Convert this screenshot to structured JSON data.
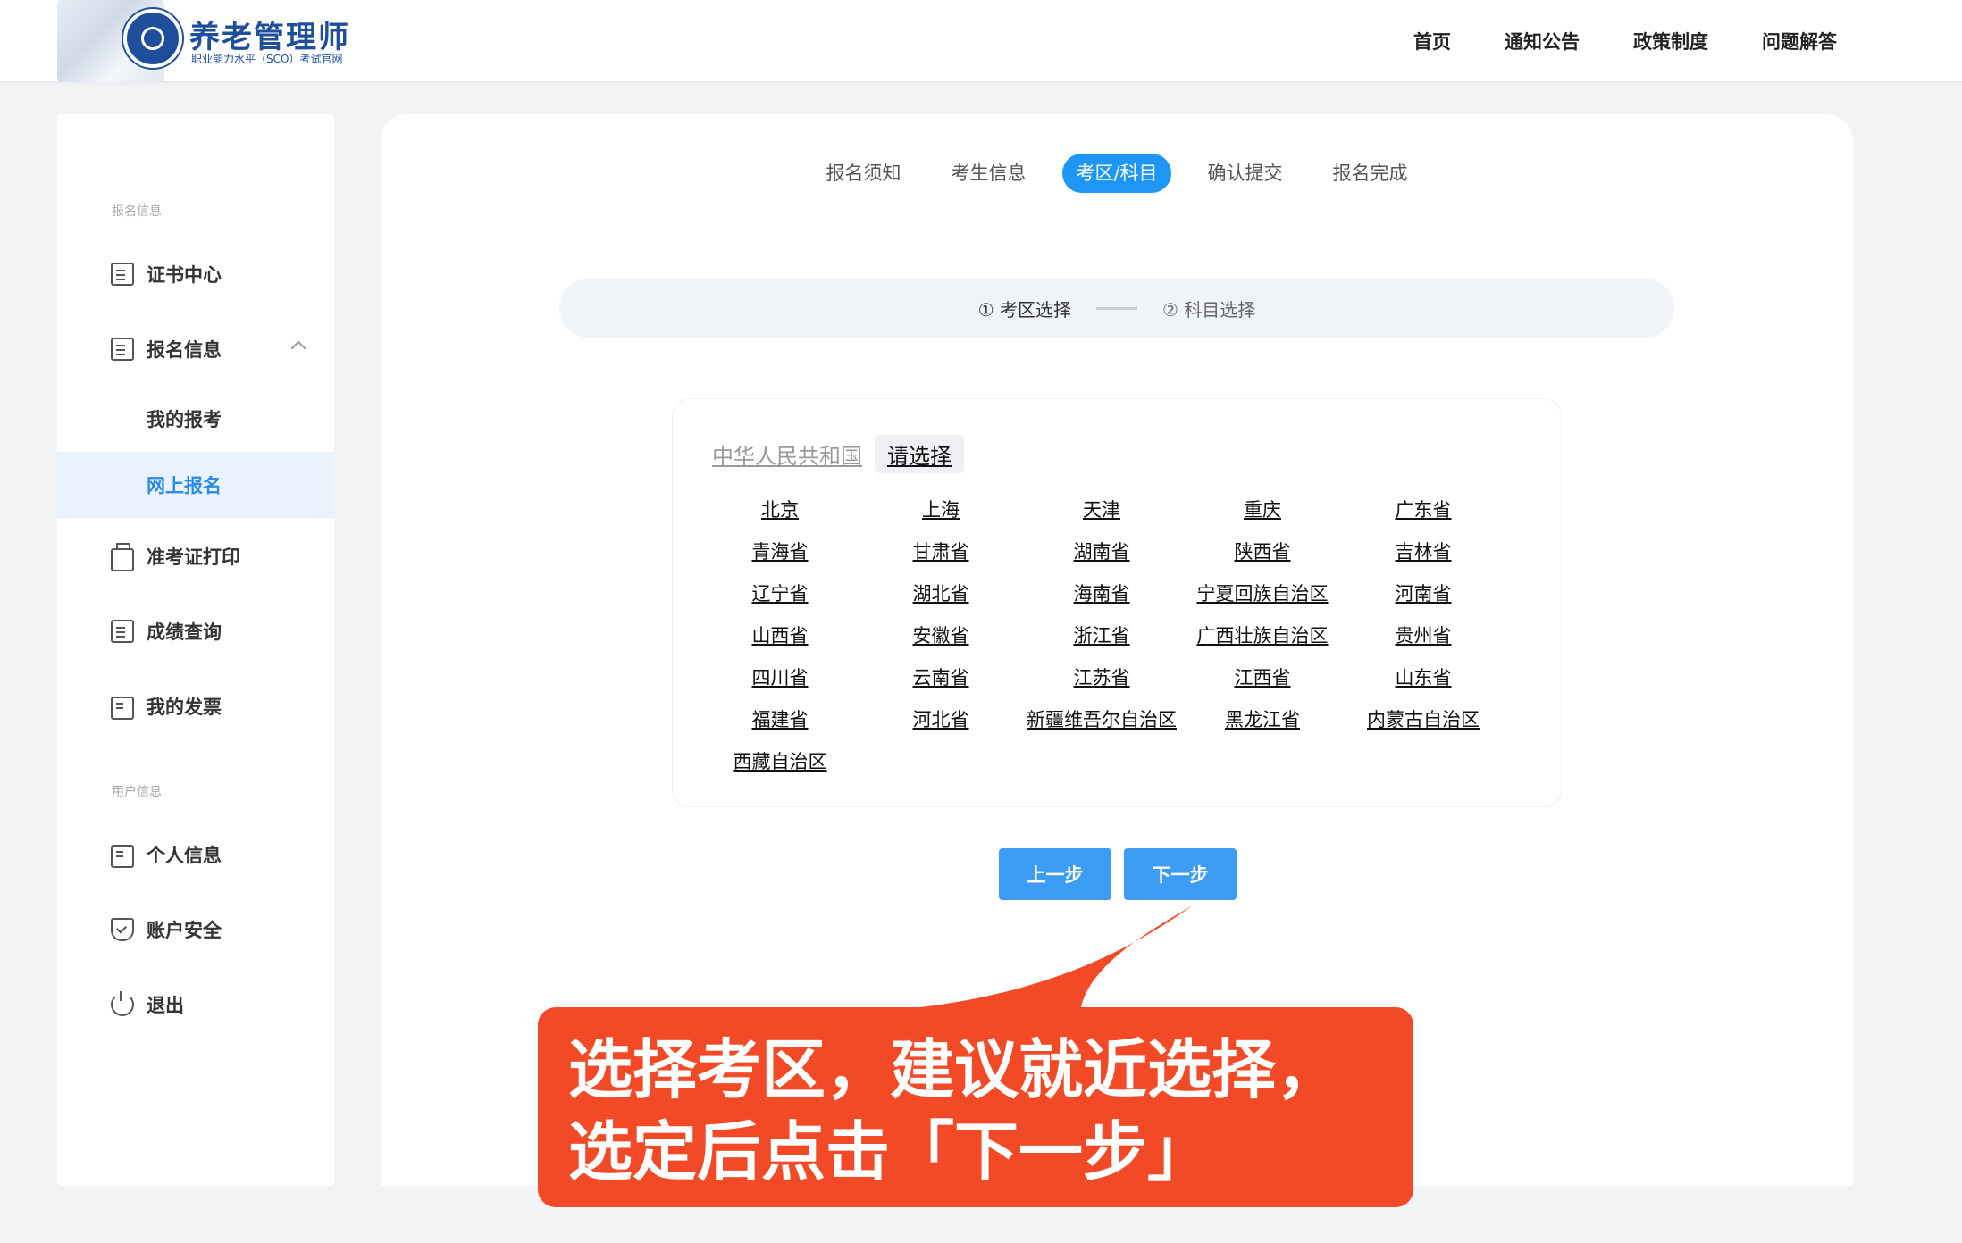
{
  "brand": {
    "title": "养老管理师",
    "subtitle": "职业能力水平（SCO）考试官网"
  },
  "topnav": [
    "首页",
    "通知公告",
    "政策制度",
    "问题解答"
  ],
  "sidebar": {
    "group1": "报名信息",
    "items": {
      "cert": "证书中心",
      "signup": "报名信息",
      "my_exam": "我的报考",
      "online": "网上报名",
      "ticket": "准考证打印",
      "score": "成绩查询",
      "invoice": "我的发票"
    },
    "group2": "用户信息",
    "items2": {
      "profile": "个人信息",
      "security": "账户安全",
      "logout": "退出"
    }
  },
  "steps": [
    "报名须知",
    "考生信息",
    "考区/科目",
    "确认提交",
    "报名完成"
  ],
  "active_step": "考区/科目",
  "substeps": {
    "one": "① 考区选择",
    "two": "② 科目选择"
  },
  "region": {
    "country": "中华人民共和国",
    "placeholder": "请选择",
    "provinces": [
      "北京",
      "上海",
      "天津",
      "重庆",
      "广东省",
      "青海省",
      "甘肃省",
      "湖南省",
      "陕西省",
      "吉林省",
      "辽宁省",
      "湖北省",
      "海南省",
      "宁夏回族自治区",
      "河南省",
      "山西省",
      "安徽省",
      "浙江省",
      "广西壮族自治区",
      "贵州省",
      "四川省",
      "云南省",
      "江苏省",
      "江西省",
      "山东省",
      "福建省",
      "河北省",
      "新疆维吾尔自治区",
      "黑龙江省",
      "内蒙古自治区",
      "西藏自治区"
    ]
  },
  "buttons": {
    "prev": "上一步",
    "next": "下一步"
  },
  "callout": {
    "line1": "选择考区，建议就近选择，",
    "line2": "选定后点击「下一步」"
  },
  "colors": {
    "accent": "#1e96f5",
    "button": "#3c9bf2",
    "callout": "#f24a26",
    "brand": "#1f4f9a"
  }
}
